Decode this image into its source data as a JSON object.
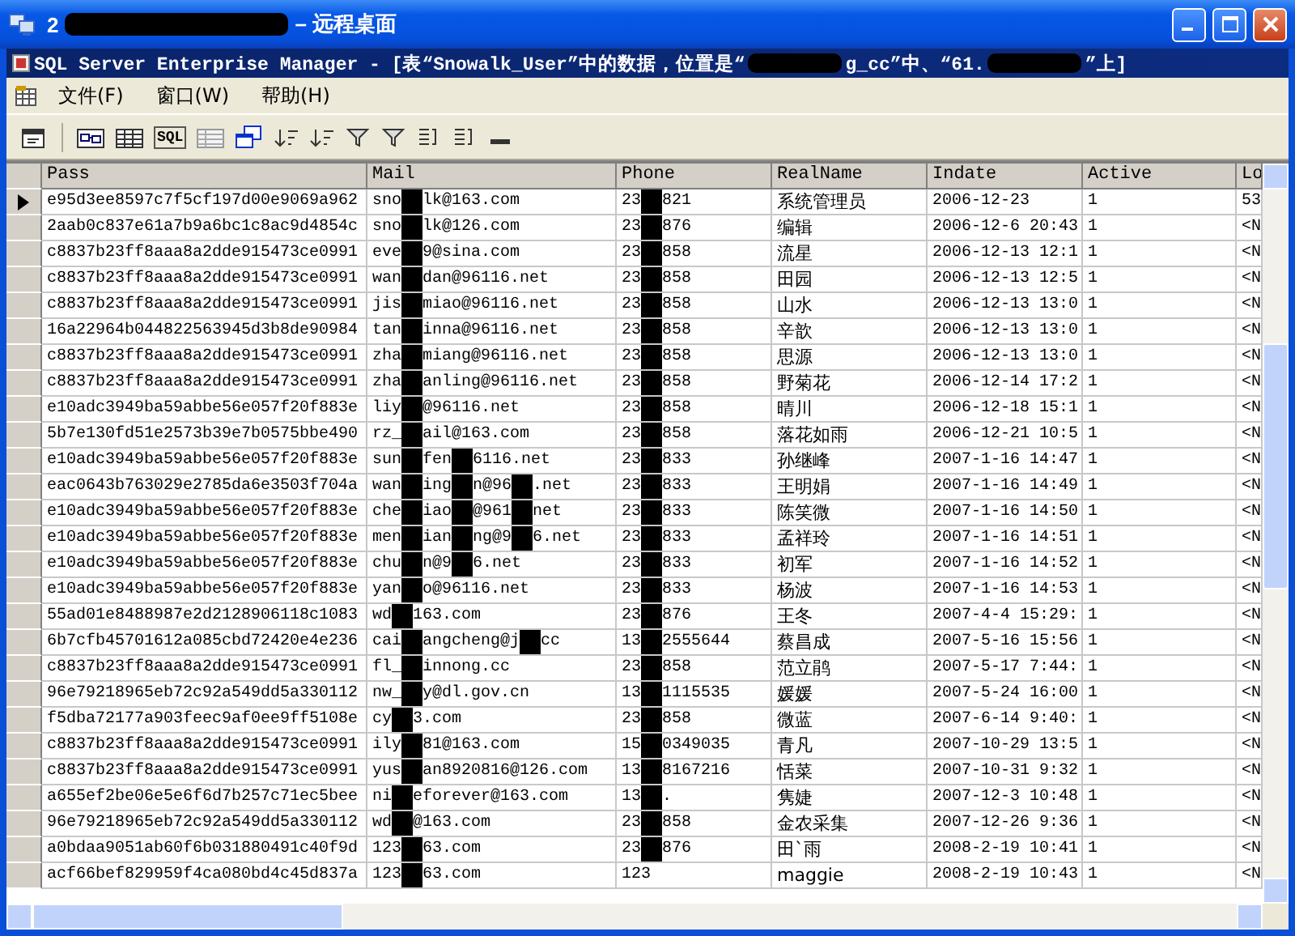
{
  "window": {
    "title": [
      "2",
      "– 远程桌面"
    ]
  },
  "document": {
    "title": [
      "SQL Server Enterprise Manager - [表“Snowalk_User”中的数据，位置是“",
      "g_cc”中、“61.",
      "”上]"
    ]
  },
  "menu": [
    "文件(F)",
    "窗口(W)",
    "帮助(H)"
  ],
  "toolbar": [
    {
      "kind": "properties"
    },
    {
      "kind": "sep"
    },
    {
      "kind": "diagram"
    },
    {
      "kind": "grid"
    },
    {
      "kind": "sql",
      "label": "SQL"
    },
    {
      "kind": "results"
    },
    {
      "kind": "run"
    },
    {
      "kind": "sort"
    },
    {
      "kind": "sort"
    },
    {
      "kind": "filter"
    },
    {
      "kind": "filter"
    },
    {
      "kind": "group"
    },
    {
      "kind": "group"
    },
    {
      "kind": "add"
    }
  ],
  "table": {
    "columns": [
      "Pass",
      "Mail",
      "Phone",
      "RealName",
      "Indate",
      "Active",
      "Lo"
    ],
    "rows": [
      {
        "current": true,
        "cells": [
          "e95d3ee8597c7f5cf197d00e9069a962",
          [
            "sno",
            "lk@163.com"
          ],
          [
            "23",
            "821"
          ],
          "系统管理员",
          "2006-12-23",
          "1",
          "53"
        ]
      },
      {
        "current": false,
        "cells": [
          "2aab0c837e61a7b9a6bc1c8ac9d4854c",
          [
            "sno",
            "lk@126.com"
          ],
          [
            "23",
            "876"
          ],
          "编辑",
          "2006-12-6 20:43",
          "1",
          "<N"
        ]
      },
      {
        "current": false,
        "cells": [
          "c8837b23ff8aaa8a2dde915473ce0991",
          [
            "eve",
            "9@sina.com"
          ],
          [
            "23",
            "858"
          ],
          "流星",
          "2006-12-13 12:1",
          "1",
          "<N"
        ]
      },
      {
        "current": false,
        "cells": [
          "c8837b23ff8aaa8a2dde915473ce0991",
          [
            "wan",
            "dan@96116.net"
          ],
          [
            "23",
            "858"
          ],
          "田园",
          "2006-12-13 12:5",
          "1",
          "<N"
        ]
      },
      {
        "current": false,
        "cells": [
          "c8837b23ff8aaa8a2dde915473ce0991",
          [
            "jis",
            "miao@96116.net"
          ],
          [
            "23",
            "858"
          ],
          "山水",
          "2006-12-13 13:0",
          "1",
          "<N"
        ]
      },
      {
        "current": false,
        "cells": [
          "16a22964b044822563945d3b8de90984",
          [
            "tan",
            "inna@96116.net"
          ],
          [
            "23",
            "858"
          ],
          "辛歆",
          "2006-12-13 13:0",
          "1",
          "<N"
        ]
      },
      {
        "current": false,
        "cells": [
          "c8837b23ff8aaa8a2dde915473ce0991",
          [
            "zha",
            "miang@96116.net"
          ],
          [
            "23",
            "858"
          ],
          "思源",
          "2006-12-13 13:0",
          "1",
          "<N"
        ]
      },
      {
        "current": false,
        "cells": [
          "c8837b23ff8aaa8a2dde915473ce0991",
          [
            "zha",
            "anling@96116.net"
          ],
          [
            "23",
            "858"
          ],
          "野菊花",
          "2006-12-14 17:2",
          "1",
          "<N"
        ]
      },
      {
        "current": false,
        "cells": [
          "e10adc3949ba59abbe56e057f20f883e",
          [
            "liy",
            "@96116.net"
          ],
          [
            "23",
            "858"
          ],
          "晴川",
          "2006-12-18 15:1",
          "1",
          "<N"
        ]
      },
      {
        "current": false,
        "cells": [
          "5b7e130fd51e2573b39e7b0575bbe490",
          [
            "rz_",
            "ail@163.com"
          ],
          [
            "23",
            "858"
          ],
          "落花如雨",
          "2006-12-21 10:5",
          "1",
          "<N"
        ]
      },
      {
        "current": false,
        "cells": [
          "e10adc3949ba59abbe56e057f20f883e",
          [
            "sun",
            "fen",
            "6116.net"
          ],
          [
            "23",
            "833"
          ],
          "孙继峰",
          "2007-1-16 14:47",
          "1",
          "<N"
        ]
      },
      {
        "current": false,
        "cells": [
          "eac0643b763029e2785da6e3503f704a",
          [
            "wan",
            "ing",
            "n@96",
            ".net"
          ],
          [
            "23",
            "833"
          ],
          "王明娟",
          "2007-1-16 14:49",
          "1",
          "<N"
        ]
      },
      {
        "current": false,
        "cells": [
          "e10adc3949ba59abbe56e057f20f883e",
          [
            "che",
            "iao",
            "@961",
            "net"
          ],
          [
            "23",
            "833"
          ],
          "陈笑微",
          "2007-1-16 14:50",
          "1",
          "<N"
        ]
      },
      {
        "current": false,
        "cells": [
          "e10adc3949ba59abbe56e057f20f883e",
          [
            "men",
            "ian",
            "ng@9",
            "6.net"
          ],
          [
            "23",
            "833"
          ],
          "孟祥玲",
          "2007-1-16 14:51",
          "1",
          "<N"
        ]
      },
      {
        "current": false,
        "cells": [
          "e10adc3949ba59abbe56e057f20f883e",
          [
            "chu",
            "n@9",
            "6.net"
          ],
          [
            "23",
            "833"
          ],
          "初军",
          "2007-1-16 14:52",
          "1",
          "<N"
        ]
      },
      {
        "current": false,
        "cells": [
          "e10adc3949ba59abbe56e057f20f883e",
          [
            "yan",
            "o@96116.net"
          ],
          [
            "23",
            "833"
          ],
          "杨波",
          "2007-1-16 14:53",
          "1",
          "<N"
        ]
      },
      {
        "current": false,
        "cells": [
          "55ad01e8488987e2d2128906118c1083",
          [
            "wd",
            "163.com"
          ],
          [
            "23",
            "876"
          ],
          "王冬",
          "2007-4-4 15:29:",
          "1",
          "<N"
        ]
      },
      {
        "current": false,
        "cells": [
          "6b7cfb45701612a085cbd72420e4e236",
          [
            "cai",
            "angcheng@j",
            "cc"
          ],
          [
            "13",
            "2555644"
          ],
          "蔡昌成",
          "2007-5-16 15:56",
          "1",
          "<N"
        ]
      },
      {
        "current": false,
        "cells": [
          "c8837b23ff8aaa8a2dde915473ce0991",
          [
            "fl_",
            "innong.cc"
          ],
          [
            "23",
            "858"
          ],
          "范立鹃",
          "2007-5-17 7:44:",
          "1",
          "<N"
        ]
      },
      {
        "current": false,
        "cells": [
          "96e79218965eb72c92a549dd5a330112",
          [
            "nw_",
            "y@dl.gov.cn"
          ],
          [
            "13",
            "1115535"
          ],
          "媛媛",
          "2007-5-24 16:00",
          "1",
          "<N"
        ]
      },
      {
        "current": false,
        "cells": [
          "f5dba72177a903feec9af0ee9ff5108e",
          [
            "cy",
            "3.com"
          ],
          [
            "23",
            "858"
          ],
          "微蓝",
          "2007-6-14 9:40:",
          "1",
          "<N"
        ]
      },
      {
        "current": false,
        "cells": [
          "c8837b23ff8aaa8a2dde915473ce0991",
          [
            "ily",
            "81@163.com"
          ],
          [
            "15",
            "0349035"
          ],
          "青凡",
          "2007-10-29 13:5",
          "1",
          "<N"
        ]
      },
      {
        "current": false,
        "cells": [
          "c8837b23ff8aaa8a2dde915473ce0991",
          [
            "yus",
            "an8920816@126.com"
          ],
          [
            "13",
            "8167216"
          ],
          "恬菜",
          "2007-10-31 9:32",
          "1",
          "<N"
        ]
      },
      {
        "current": false,
        "cells": [
          "a655ef2be06e5e6f6d7b257c71ec5bee",
          [
            "ni",
            "eforever@163.com"
          ],
          [
            "13",
            "."
          ],
          "隽婕",
          "2007-12-3 10:48",
          "1",
          "<N"
        ]
      },
      {
        "current": false,
        "cells": [
          "96e79218965eb72c92a549dd5a330112",
          [
            "wd",
            "@163.com"
          ],
          [
            "23",
            "858"
          ],
          "金农采集",
          "2007-12-26 9:36",
          "1",
          "<N"
        ]
      },
      {
        "current": false,
        "cells": [
          "a0bdaa9051ab60f6b031880491c40f9d",
          [
            "123",
            "63.com"
          ],
          [
            "23",
            "876"
          ],
          "田`雨",
          "2008-2-19 10:41",
          "1",
          "<N"
        ]
      },
      {
        "current": false,
        "cells": [
          "acf66bef829959f4ca080bd4c45d837a",
          [
            "123",
            "63.com"
          ],
          "123",
          "maggie",
          "2008-2-19 10:43",
          "1",
          "<N"
        ]
      }
    ]
  }
}
